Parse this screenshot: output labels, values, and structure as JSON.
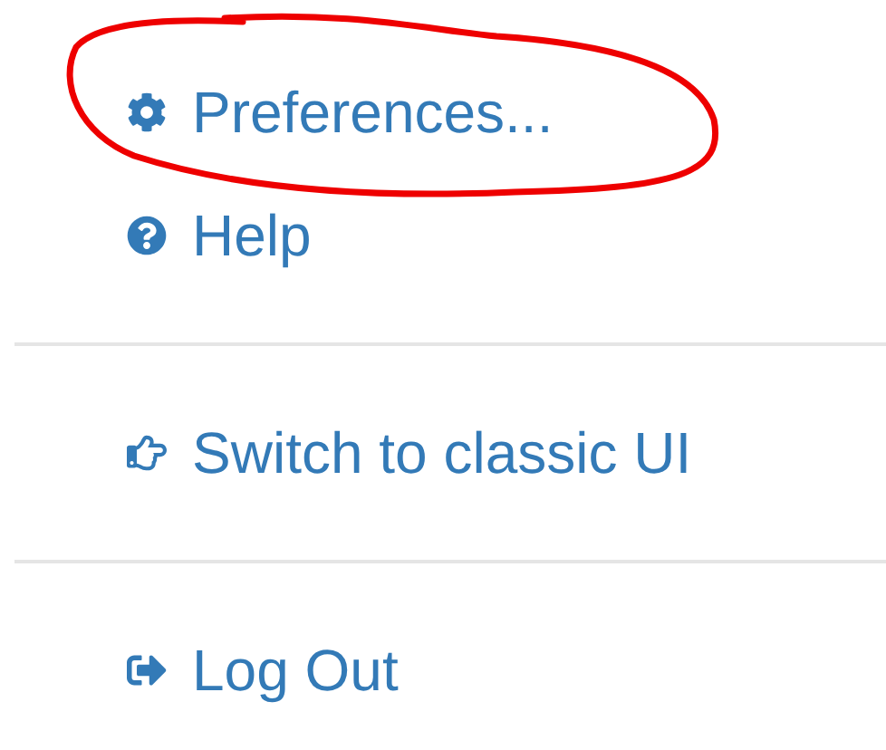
{
  "menu": {
    "sections": [
      {
        "items": [
          {
            "kind": "preferences",
            "label": "Preferences...",
            "circled": true
          },
          {
            "kind": "help",
            "label": "Help",
            "circled": false
          }
        ]
      },
      {
        "items": [
          {
            "kind": "switch",
            "label": "Switch to classic UI",
            "circled": false
          }
        ]
      },
      {
        "items": [
          {
            "kind": "logout",
            "label": "Log Out",
            "circled": false
          }
        ]
      }
    ]
  }
}
